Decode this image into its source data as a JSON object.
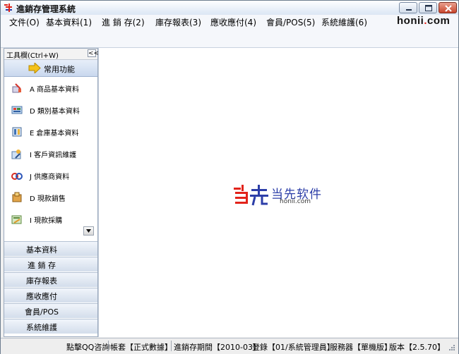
{
  "window": {
    "title": "進銷存管理系統",
    "icon": "app-logo-icon",
    "controls": [
      "minimize-icon",
      "maximize-icon",
      "close-icon"
    ]
  },
  "menubar": {
    "items": [
      {
        "label": "文件(O)"
      },
      {
        "label": "基本資料(1)"
      },
      {
        "label": "進 銷 存(2)"
      },
      {
        "label": "庫存報表(3)"
      },
      {
        "label": "應收應付(4)"
      },
      {
        "label": "會員/POS(5)"
      },
      {
        "label": "系統維護(6)"
      }
    ],
    "brand_text": "honii",
    "brand_dot": ".",
    "brand_tld": "com"
  },
  "sidebar": {
    "header": "工具欄(Ctrl+W)",
    "collapse_label": "<<",
    "common_title": "常用功能",
    "functions": [
      {
        "label": "A 商品基本資料",
        "icon": "product-icon"
      },
      {
        "label": "D 類別基本資料",
        "icon": "category-icon"
      },
      {
        "label": "E 倉庫基本資料",
        "icon": "warehouse-icon"
      },
      {
        "label": "I 客戶資訊維護",
        "icon": "customer-icon"
      },
      {
        "label": "J 供應商資料",
        "icon": "supplier-icon"
      },
      {
        "label": "D 現款銷售",
        "icon": "cash-sale-icon"
      },
      {
        "label": "I 現款採購",
        "icon": "cash-purchase-icon"
      }
    ],
    "groups": [
      {
        "label": "基本資料"
      },
      {
        "label": "進 銷 存"
      },
      {
        "label": "庫存報表"
      },
      {
        "label": "應收應付"
      },
      {
        "label": "會員/POS"
      },
      {
        "label": "系統維護"
      }
    ]
  },
  "main": {
    "logo_cn": "当先软件",
    "logo_url": "honii.com"
  },
  "statusbar": {
    "segments": [
      {
        "label": "點擊QQ咨詢"
      },
      {
        "label": "帳套【正式數據】"
      },
      {
        "label": "進銷存期間【2010-03】"
      },
      {
        "label": "登錄【01/系統管理員】"
      },
      {
        "label": "服務器【單機版】"
      },
      {
        "label": "版本【2.5.70】"
      }
    ]
  },
  "colors": {
    "accent": "#2c3ea8",
    "brand_red": "#e2231a",
    "logo_red": "#e2231a",
    "logo_blue": "#2c3ea8",
    "close_button": "#c8452c"
  }
}
